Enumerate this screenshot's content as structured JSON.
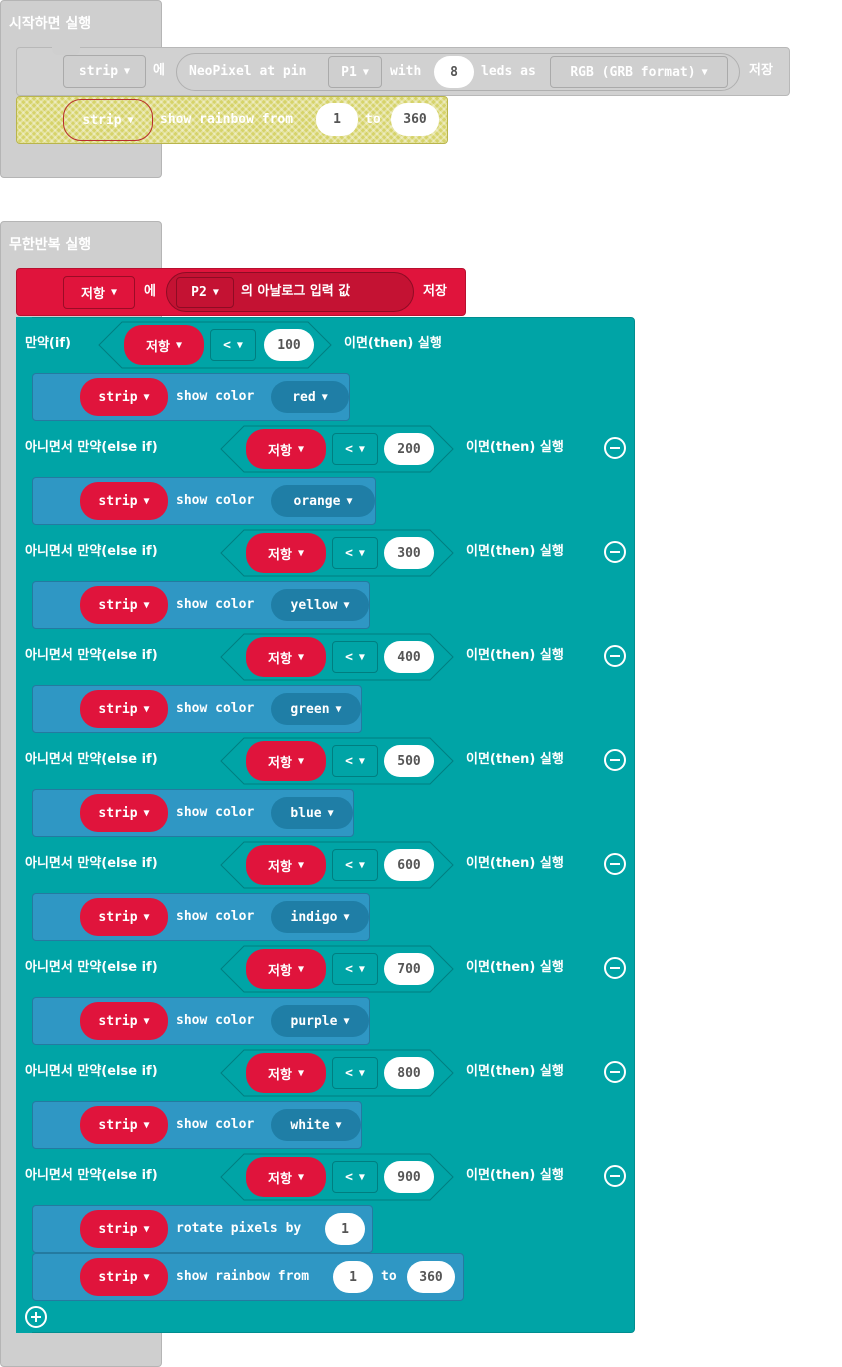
{
  "on_start": {
    "title": "시작하면 실행",
    "row1": {
      "var_label": "strip",
      "op_label": "에",
      "neopixel_label": "NeoPixel at pin",
      "pin_label": "P1",
      "with_label": "with",
      "leds_value": "8",
      "leds_label": "leds as",
      "format_label": "RGB (GRB format)",
      "save_label": "저장"
    },
    "row2": {
      "var_label": "strip",
      "action_label": "show rainbow from",
      "from_value": "1",
      "to_label": "to",
      "to_value": "360"
    }
  },
  "forever": {
    "title": "무한반복 실행",
    "set_row": {
      "var_label": "저항",
      "op_label": "에",
      "pin_label": "P2",
      "analog_label": "의 아날로그 입력 값",
      "save_label": "저장"
    },
    "if_label": "만약(if)",
    "elseif_label": "아니면서 만약(else if)",
    "then_label": "이면(then) 실행",
    "var_label": "저항",
    "cmp_label": "<",
    "strip_label": "strip",
    "show_color_label": "show color",
    "branches": [
      {
        "threshold": "100",
        "color": "red"
      },
      {
        "threshold": "200",
        "color": "orange"
      },
      {
        "threshold": "300",
        "color": "yellow"
      },
      {
        "threshold": "400",
        "color": "green"
      },
      {
        "threshold": "500",
        "color": "blue"
      },
      {
        "threshold": "600",
        "color": "indigo"
      },
      {
        "threshold": "700",
        "color": "purple"
      },
      {
        "threshold": "800",
        "color": "white"
      },
      {
        "threshold": "900",
        "color": ""
      }
    ],
    "last": {
      "rotate_label": "rotate pixels by",
      "rotate_value": "1",
      "rainbow_label": "show rainbow from",
      "from_value": "1",
      "to_label": "to",
      "to_value": "360"
    }
  },
  "colors": {
    "hat": "#cfcfcf",
    "neopixel_gray": "#d1d1d1",
    "variable_red": "#e0143c",
    "logic_teal": "#00a4a6",
    "neopixel_blue": "#2f97c4",
    "dropdown_dark_blue": "#1f7ea6"
  }
}
